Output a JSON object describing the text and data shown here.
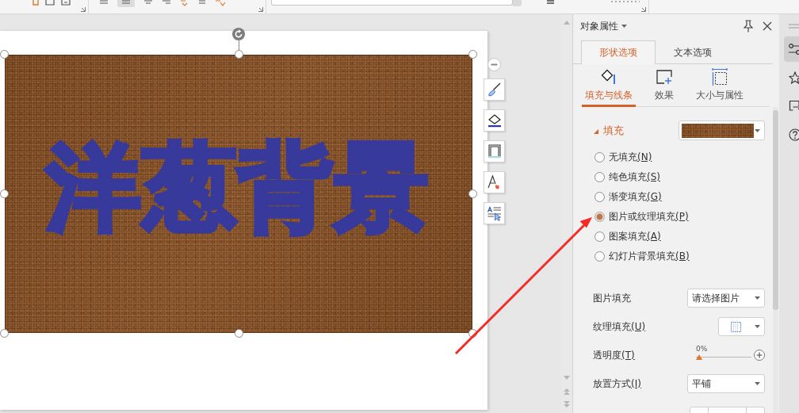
{
  "slide": {
    "shape": {
      "text": "洋葱背景",
      "selected": true
    }
  },
  "panel": {
    "title": "对象属性",
    "tabs": [
      {
        "label": "形状选项",
        "selected": true
      },
      {
        "label": "文本选项",
        "selected": false
      }
    ],
    "subtabs": [
      {
        "label": "填充与线条",
        "selected": true
      },
      {
        "label": "效果",
        "selected": false
      },
      {
        "label": "大小与属性",
        "selected": false
      }
    ],
    "section": {
      "title": "填充",
      "expanded": true
    },
    "fill_options": [
      {
        "label": "无填充",
        "accel": "(N)",
        "selected": false
      },
      {
        "label": "纯色填充",
        "accel": "(S)",
        "selected": false
      },
      {
        "label": "渐变填充",
        "accel": "(G)",
        "selected": false
      },
      {
        "label": "图片或纹理填充",
        "accel": "(P)",
        "selected": true
      },
      {
        "label": "图案填充",
        "accel": "(A)",
        "selected": false
      },
      {
        "label": "幻灯片背景填充",
        "accel": "(B)",
        "selected": false
      }
    ],
    "fields": [
      {
        "kind": "dropdown",
        "label": "图片填充",
        "value": "请选择图片"
      },
      {
        "kind": "texture",
        "label": "纹理填充",
        "accel": "(U)"
      },
      {
        "kind": "slider",
        "label": "透明度",
        "accel": "(T)",
        "level": 0,
        "reading": "0%"
      },
      {
        "kind": "dropdown",
        "label": "放置方式",
        "accel": "(I)",
        "value": "平铺"
      },
      {
        "kind": "spinner"
      }
    ]
  },
  "sidebar": {
    "items": [
      {
        "selected": true
      },
      {
        "selected": false
      },
      {
        "selected": false
      },
      {
        "selected": false
      }
    ]
  }
}
